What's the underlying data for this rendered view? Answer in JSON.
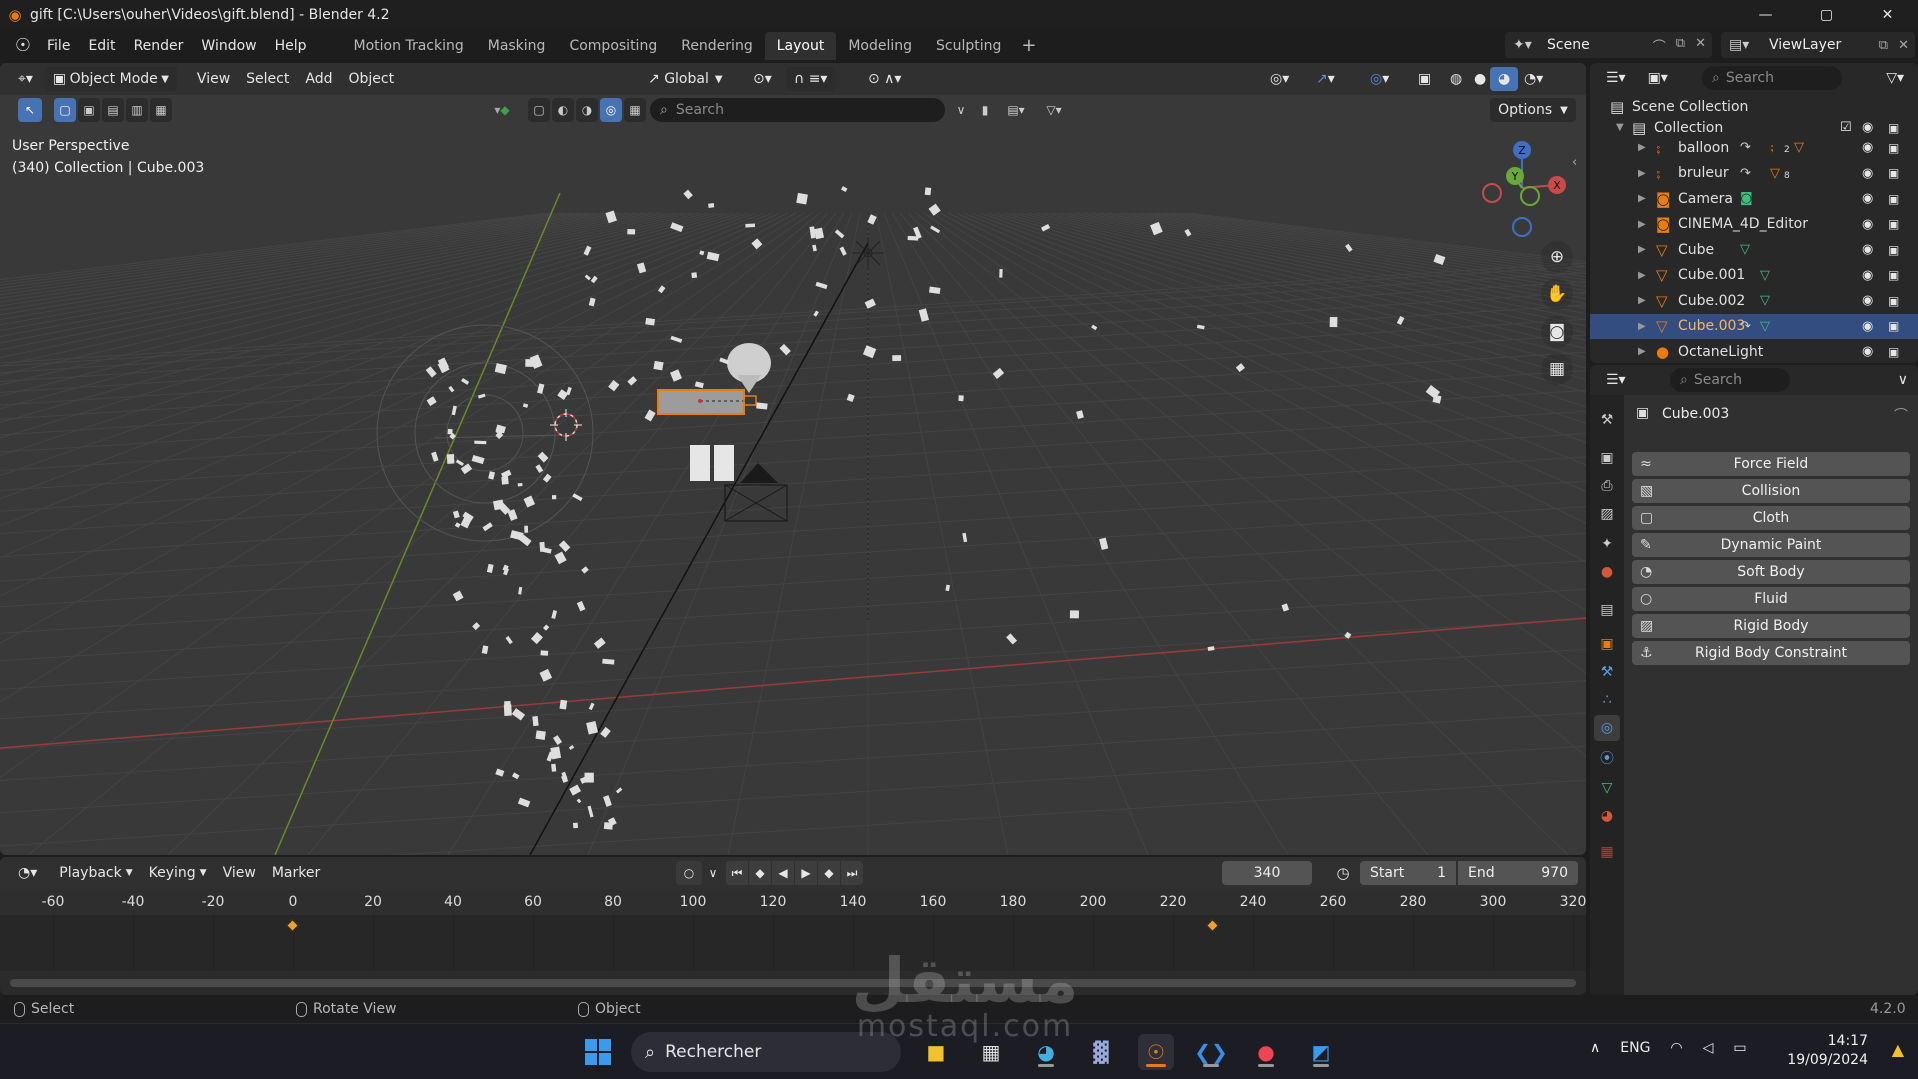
{
  "window": {
    "title": "gift [C:\\Users\\ouher\\Videos\\gift.blend] - Blender 4.2",
    "minimize": "—",
    "maximize": "▢",
    "close": "✕"
  },
  "menu": [
    "File",
    "Edit",
    "Render",
    "Window",
    "Help"
  ],
  "workspaces": [
    {
      "label": "Motion Tracking",
      "active": false
    },
    {
      "label": "Masking",
      "active": false
    },
    {
      "label": "Compositing",
      "active": false
    },
    {
      "label": "Rendering",
      "active": false
    },
    {
      "label": "Layout",
      "active": true
    },
    {
      "label": "Modeling",
      "active": false
    },
    {
      "label": "Sculpting",
      "active": false
    }
  ],
  "scene": {
    "label": "Scene",
    "view_layer": "ViewLayer"
  },
  "viewport": {
    "mode": "Object Mode",
    "menus": [
      "View",
      "Select",
      "Add",
      "Object"
    ],
    "transform_orientation": "Global",
    "search_placeholder": "Search",
    "options_label": "Options",
    "info_line1": "User Perspective",
    "info_line2": "(340) Collection | Cube.003",
    "gizmo": {
      "x": "X",
      "y": "Y",
      "z": "Z"
    }
  },
  "timeline": {
    "menus": [
      "Playback",
      "Keying",
      "View",
      "Marker"
    ],
    "current_frame": "340",
    "start_label": "Start",
    "start_value": "1",
    "end_label": "End",
    "end_value": "970",
    "ruler_ticks": [
      "-60",
      "-40",
      "-20",
      "0",
      "20",
      "40",
      "60",
      "80",
      "100",
      "120",
      "140",
      "160",
      "180",
      "200",
      "220",
      "240",
      "260",
      "280",
      "300",
      "320"
    ],
    "keyframes": [
      0,
      230
    ]
  },
  "statusbar": {
    "select": "Select",
    "rotate": "Rotate View",
    "object": "Object",
    "version": "4.2.0"
  },
  "outliner": {
    "search_placeholder": "Search",
    "scene_collection": "Scene Collection",
    "collection": "Collection",
    "items": [
      {
        "name": "balloon",
        "icon": "armature-icon",
        "selected": false
      },
      {
        "name": "bruleur",
        "icon": "armature-icon",
        "selected": false
      },
      {
        "name": "Camera",
        "icon": "camera-icon",
        "selected": false
      },
      {
        "name": "CINEMA_4D_Editor",
        "icon": "camera-icon",
        "selected": false
      },
      {
        "name": "Cube",
        "icon": "mesh-icon",
        "selected": false
      },
      {
        "name": "Cube.001",
        "icon": "mesh-icon",
        "selected": false
      },
      {
        "name": "Cube.002",
        "icon": "mesh-icon",
        "selected": false
      },
      {
        "name": "Cube.003",
        "icon": "mesh-icon",
        "selected": true
      },
      {
        "name": "OctaneLight",
        "icon": "light-icon",
        "selected": false
      }
    ],
    "badges": {
      "balloon_a": "2",
      "bruleur_a": "8"
    }
  },
  "properties": {
    "search_placeholder": "Search",
    "object_name": "Cube.003",
    "physics_buttons": [
      "Force Field",
      "Collision",
      "Cloth",
      "Dynamic Paint",
      "Soft Body",
      "Fluid",
      "Rigid Body",
      "Rigid Body Constraint"
    ]
  },
  "taskbar": {
    "search_placeholder": "Rechercher",
    "language": "ENG",
    "time": "14:17",
    "date": "19/09/2024"
  },
  "watermark": {
    "arabic": "مستقل",
    "latin": "mostaql.com"
  },
  "colors": {
    "accent": "#4772b3",
    "selection_orange": "#e87d0d",
    "selected_row": "#334d80",
    "keyframe": "#f0a030"
  }
}
